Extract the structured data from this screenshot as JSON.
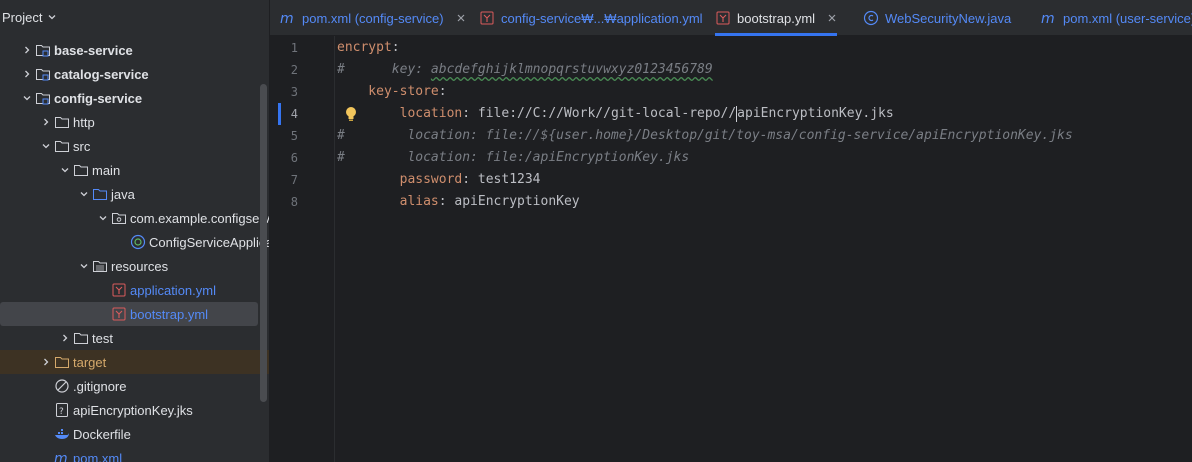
{
  "panel": {
    "title": "Project"
  },
  "tree": [
    {
      "label": "base-service",
      "bold": true,
      "indent": 1,
      "arrow": "right",
      "icon": "module-folder-icon"
    },
    {
      "label": "catalog-service",
      "bold": true,
      "indent": 1,
      "arrow": "right",
      "icon": "module-folder-icon"
    },
    {
      "label": "config-service",
      "bold": true,
      "indent": 1,
      "arrow": "down",
      "icon": "module-folder-icon"
    },
    {
      "label": "http",
      "indent": 2,
      "arrow": "right",
      "icon": "folder-icon"
    },
    {
      "label": "src",
      "indent": 2,
      "arrow": "down",
      "icon": "folder-icon"
    },
    {
      "label": "main",
      "indent": 3,
      "arrow": "down",
      "icon": "folder-icon"
    },
    {
      "label": "java",
      "indent": 4,
      "arrow": "down",
      "icon": "source-folder-icon"
    },
    {
      "label": "com.example.configservice",
      "indent": 5,
      "arrow": "down",
      "icon": "package-icon"
    },
    {
      "label": "ConfigServiceApplication",
      "indent": 6,
      "arrow": "none",
      "icon": "spring-class-icon"
    },
    {
      "label": "resources",
      "indent": 4,
      "arrow": "down",
      "icon": "resources-folder-icon"
    },
    {
      "label": "application.yml",
      "indent": 5,
      "arrow": "none",
      "icon": "yaml-file-icon",
      "color": "#548af7"
    },
    {
      "label": "bootstrap.yml",
      "indent": 5,
      "arrow": "none",
      "icon": "yaml-file-icon",
      "color": "#548af7",
      "selected": true
    },
    {
      "label": "test",
      "indent": 3,
      "arrow": "right",
      "icon": "folder-icon"
    },
    {
      "label": "target",
      "indent": 2,
      "arrow": "right",
      "icon": "excluded-folder-icon",
      "color": "#d5a96b",
      "excluded": true
    },
    {
      "label": ".gitignore",
      "indent": 2,
      "arrow": "none",
      "icon": "ignore-file-icon"
    },
    {
      "label": "apiEncryptionKey.jks",
      "indent": 2,
      "arrow": "none",
      "icon": "unknown-file-icon"
    },
    {
      "label": "Dockerfile",
      "indent": 2,
      "arrow": "none",
      "icon": "docker-icon"
    },
    {
      "label": "pom.xml",
      "indent": 2,
      "arrow": "none",
      "icon": "maven-icon",
      "color": "#548af7"
    }
  ],
  "tabs": [
    {
      "label": "pom.xml (config-service)",
      "icon": "maven-icon",
      "color": "#548af7",
      "closable": true
    },
    {
      "label": "config-service₩...₩application.yml",
      "icon": "yaml-file-icon",
      "color": "#548af7"
    },
    {
      "label": "bootstrap.yml",
      "icon": "yaml-file-icon",
      "color": "#dfe1e5",
      "closable": true,
      "active": true
    },
    {
      "label": "WebSecurityNew.java",
      "icon": "class-icon",
      "color": "#548af7"
    },
    {
      "label": "pom.xml (user-service)",
      "icon": "maven-icon",
      "color": "#548af7"
    }
  ],
  "editor": {
    "current_line": 4,
    "lines": [
      {
        "num": "1",
        "segs": [
          {
            "t": "encrypt",
            "c": "k"
          },
          {
            "t": ":",
            "c": "v"
          }
        ]
      },
      {
        "num": "2",
        "segs": [
          {
            "t": "#      key: ",
            "c": "c"
          },
          {
            "t": "abcdefghijklmnopqrstuvwxyz0123456789",
            "c": "c c-under"
          }
        ]
      },
      {
        "num": "3",
        "segs": [
          {
            "t": "    key-store",
            "c": "k"
          },
          {
            "t": ":",
            "c": "v"
          }
        ]
      },
      {
        "num": "4",
        "bulb": true,
        "segs": [
          {
            "t": "        location",
            "c": "k"
          },
          {
            "t": ": file://C://Work//git-local-repo//",
            "c": "v"
          },
          {
            "t": "",
            "c": "caret"
          },
          {
            "t": "apiEncryptionKey.jks",
            "c": "v"
          }
        ]
      },
      {
        "num": "5",
        "segs": [
          {
            "t": "#        location: file://${user.home}/Desktop/git/toy-msa/config-service/apiEncryptionKey.jks",
            "c": "c"
          }
        ]
      },
      {
        "num": "6",
        "segs": [
          {
            "t": "#        location: file:/apiEncryptionKey.jks",
            "c": "c"
          }
        ]
      },
      {
        "num": "7",
        "segs": [
          {
            "t": "        password",
            "c": "k"
          },
          {
            "t": ": test1234",
            "c": "v"
          }
        ]
      },
      {
        "num": "8",
        "segs": [
          {
            "t": "        alias",
            "c": "k"
          },
          {
            "t": ": apiEncryptionKey",
            "c": "v"
          }
        ]
      }
    ]
  }
}
